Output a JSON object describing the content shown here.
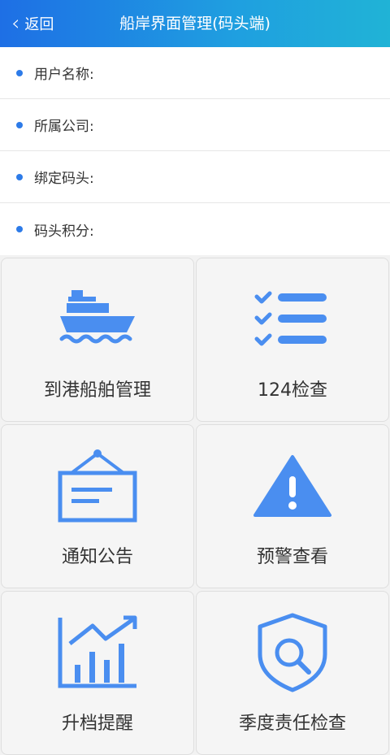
{
  "header": {
    "back_label": "返回",
    "title": "船岸界面管理(码头端)"
  },
  "info": [
    {
      "label": "用户名称:"
    },
    {
      "label": "所属公司:"
    },
    {
      "label": "绑定码头:"
    },
    {
      "label": "码头积分:"
    }
  ],
  "menu": [
    {
      "label": "到港船舶管理",
      "icon": "ship-icon"
    },
    {
      "label": "124检查",
      "icon": "checklist-icon"
    },
    {
      "label": "通知公告",
      "icon": "notice-board-icon"
    },
    {
      "label": "预警查看",
      "icon": "warning-icon"
    },
    {
      "label": "升档提醒",
      "icon": "growth-chart-icon"
    },
    {
      "label": "季度责任检查",
      "icon": "shield-search-icon"
    }
  ],
  "colors": {
    "accent": "#4a8ef0",
    "header_start": "#1e6fe5",
    "header_end": "#20b3d6",
    "dot": "#2d7be8"
  }
}
